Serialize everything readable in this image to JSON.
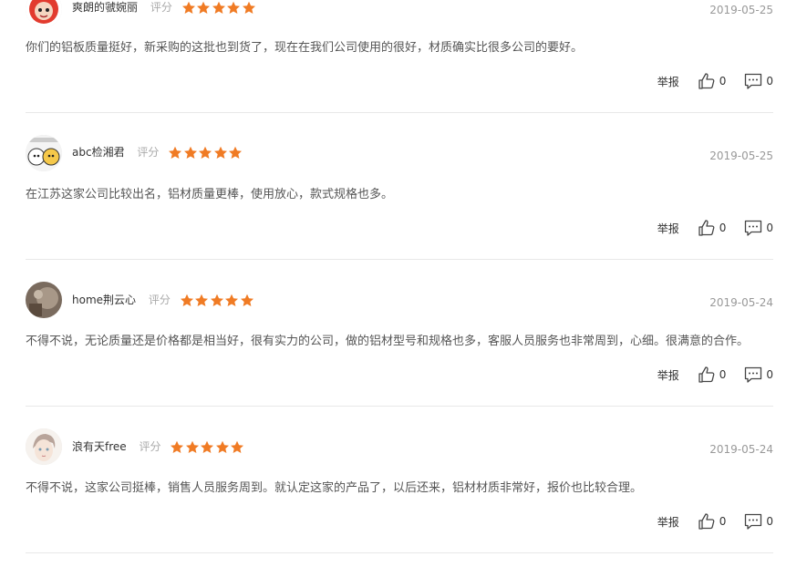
{
  "reviews": [
    {
      "username": "爽朗的虢婉丽",
      "rating_label": "评分",
      "stars": 5,
      "date": "2019-05-25",
      "content": "你们的铝板质量挺好，新采购的这批也到货了，现在在我们公司使用的很好，材质确实比很多公司的要好。",
      "report_label": "举报",
      "likes": "0",
      "comments": "0"
    },
    {
      "username": "abc检湘君",
      "rating_label": "评分",
      "stars": 5,
      "date": "2019-05-25",
      "content": "在江苏这家公司比较出名，铝材质量更棒，使用放心，款式规格也多。",
      "report_label": "举报",
      "likes": "0",
      "comments": "0"
    },
    {
      "username": "home荆云心",
      "rating_label": "评分",
      "stars": 5,
      "date": "2019-05-24",
      "content": "不得不说，无论质量还是价格都是相当好，很有实力的公司，做的铝材型号和规格也多，客服人员服务也非常周到，心细。很满意的合作。",
      "report_label": "举报",
      "likes": "0",
      "comments": "0"
    },
    {
      "username": "浪有天free",
      "rating_label": "评分",
      "stars": 5,
      "date": "2019-05-24",
      "content": "不得不说，这家公司挺棒，销售人员服务周到。就认定这家的产品了，以后还来，铝材材质非常好，报价也比较合理。",
      "report_label": "举报",
      "likes": "0",
      "comments": "0"
    }
  ],
  "colors": {
    "star": "#f07b24",
    "divider": "#e8e8e8",
    "date": "#999999",
    "content": "#555555"
  }
}
